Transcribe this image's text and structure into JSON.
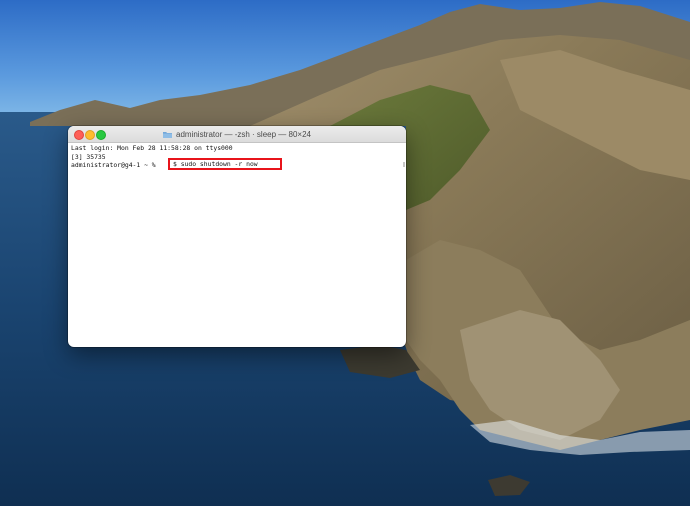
{
  "terminal": {
    "title": "administrator — -zsh · sleep — 80×24",
    "lines": [
      "Last login: Mon Feb 28 11:58:28 on ttys000",
      "[3] 35735"
    ],
    "prompt": "administrator@g4-1 ~ %",
    "command": "$ sudo shutdown -r now",
    "highlight_color": "#e8141b"
  },
  "icons": {
    "close": "close-icon",
    "minimize": "minimize-icon",
    "zoom": "zoom-icon",
    "folder": "folder-icon"
  }
}
